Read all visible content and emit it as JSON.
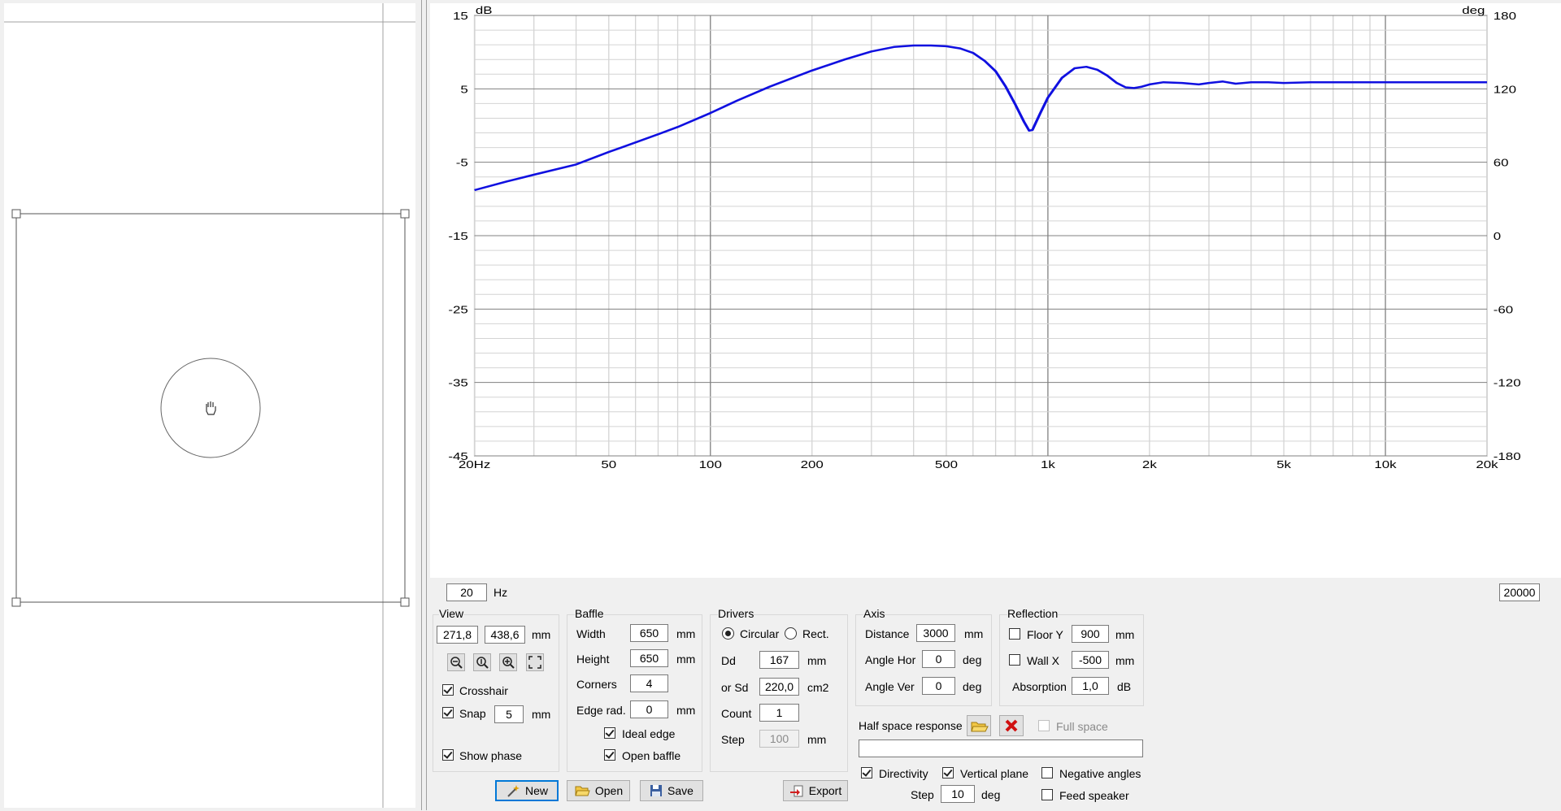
{
  "chart_data": {
    "type": "line",
    "x_axis": {
      "scale": "log",
      "range": [
        20,
        20000
      ],
      "tick_labels": [
        "20Hz",
        "50",
        "100",
        "200",
        "500",
        "1k",
        "2k",
        "5k",
        "10k",
        "20k"
      ]
    },
    "y_axis_left": {
      "unit": "dB",
      "range": [
        -45,
        15
      ],
      "tick_labels": [
        "15",
        "5",
        "-5",
        "-15",
        "-25",
        "-35",
        "-45"
      ]
    },
    "y_axis_right": {
      "unit": "deg",
      "range": [
        -180,
        180
      ],
      "tick_labels": [
        "180",
        "120",
        "60",
        "0",
        "-60",
        "-120",
        "-180"
      ]
    },
    "grid": true,
    "series": [
      {
        "color": "#1010e0",
        "x": [
          20,
          25,
          30,
          40,
          50,
          60,
          70,
          80,
          100,
          120,
          150,
          200,
          250,
          300,
          350,
          400,
          450,
          500,
          550,
          600,
          650,
          700,
          750,
          800,
          850,
          880,
          900,
          950,
          1000,
          1100,
          1200,
          1300,
          1400,
          1500,
          1600,
          1700,
          1800,
          1900,
          2000,
          2200,
          2500,
          2800,
          3000,
          3300,
          3600,
          4000,
          4500,
          5000,
          6000,
          7000,
          8000,
          10000,
          12000,
          15000,
          20000
        ],
        "y": [
          -8.8,
          -7.6,
          -6.7,
          -5.3,
          -3.6,
          -2.3,
          -1.2,
          -0.2,
          1.7,
          3.4,
          5.3,
          7.5,
          9.0,
          10.1,
          10.7,
          10.9,
          10.9,
          10.8,
          10.5,
          9.9,
          8.8,
          7.4,
          5.3,
          2.9,
          0.5,
          -0.7,
          -0.6,
          1.7,
          3.8,
          6.5,
          7.8,
          8.0,
          7.6,
          6.8,
          5.8,
          5.2,
          5.1,
          5.3,
          5.6,
          5.9,
          5.8,
          5.6,
          5.8,
          6.0,
          5.7,
          5.9,
          5.9,
          5.8,
          5.9,
          5.9,
          5.9,
          5.9,
          5.9,
          5.9,
          5.9
        ]
      }
    ]
  },
  "freq": {
    "min": "20",
    "max": "20000",
    "unit": "Hz"
  },
  "view": {
    "title": "View",
    "x": "271,8",
    "y": "438,6",
    "unit": "mm",
    "crosshair": "Crosshair",
    "snap": "Snap",
    "snap_value": "5",
    "snap_unit": "mm",
    "show_phase": "Show phase"
  },
  "baffle": {
    "title": "Baffle",
    "width_label": "Width",
    "width": "650",
    "height_label": "Height",
    "height": "650",
    "corners_label": "Corners",
    "corners": "4",
    "edge_label": "Edge rad.",
    "edge": "0",
    "unit": "mm",
    "ideal_edge": "Ideal edge",
    "open_baffle": "Open baffle"
  },
  "drivers": {
    "title": "Drivers",
    "circular": "Circular",
    "rect": "Rect.",
    "dd_label": "Dd",
    "dd": "167",
    "dd_unit": "mm",
    "sd_label": "or Sd",
    "sd": "220,0",
    "sd_unit": "cm2",
    "count_label": "Count",
    "count": "1",
    "step_label": "Step",
    "step": "100",
    "step_unit": "mm"
  },
  "axis": {
    "title": "Axis",
    "distance_label": "Distance",
    "distance": "3000",
    "distance_unit": "mm",
    "hor_label": "Angle Hor",
    "hor": "0",
    "hor_unit": "deg",
    "ver_label": "Angle Ver",
    "ver": "0",
    "ver_unit": "deg"
  },
  "reflection": {
    "title": "Reflection",
    "floor_label": "Floor Y",
    "floor": "900",
    "floor_unit": "mm",
    "wall_label": "Wall  X",
    "wall": "-500",
    "wall_unit": "mm",
    "absorption_label": "Absorption",
    "absorption": "1,0",
    "absorption_unit": "dB"
  },
  "half_space": {
    "label": "Half space response",
    "full_space": "Full space",
    "path": ""
  },
  "options": {
    "directivity": "Directivity",
    "vertical_plane": "Vertical plane",
    "negative_angles": "Negative angles",
    "step_label": "Step",
    "step": "10",
    "step_unit": "deg",
    "feed_speaker": "Feed speaker"
  },
  "buttons": {
    "new": "New",
    "open": "Open",
    "save": "Save",
    "export": "Export"
  },
  "colors": {
    "curve": "#1010e0",
    "grid_major": "#808080",
    "grid_minor": "#d4d4d4"
  }
}
